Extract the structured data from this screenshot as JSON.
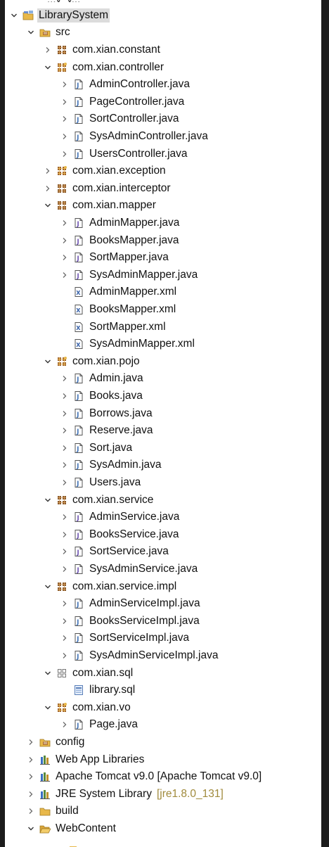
{
  "tree": {
    "cut_top_text": "...y_y...",
    "rows": [
      {
        "label": "LibrarySystem",
        "depth": 0,
        "expanded": true,
        "icon": "project-icon",
        "selected": true
      },
      {
        "label": "src",
        "depth": 1,
        "expanded": true,
        "icon": "source-folder-icon"
      },
      {
        "label": "com.xian.constant",
        "depth": 2,
        "expanded": false,
        "icon": "package-icon"
      },
      {
        "label": "com.xian.controller",
        "depth": 2,
        "expanded": true,
        "icon": "package-open-icon"
      },
      {
        "label": "AdminController.java",
        "depth": 3,
        "expanded": false,
        "icon": "java-class-icon"
      },
      {
        "label": "PageController.java",
        "depth": 3,
        "expanded": false,
        "icon": "java-class-icon"
      },
      {
        "label": "SortController.java",
        "depth": 3,
        "expanded": false,
        "icon": "java-class-icon"
      },
      {
        "label": "SysAdminController.java",
        "depth": 3,
        "expanded": false,
        "icon": "java-class-icon"
      },
      {
        "label": "UsersController.java",
        "depth": 3,
        "expanded": false,
        "icon": "java-class-icon"
      },
      {
        "label": "com.xian.exception",
        "depth": 2,
        "expanded": false,
        "icon": "package-open-icon"
      },
      {
        "label": "com.xian.interceptor",
        "depth": 2,
        "expanded": false,
        "icon": "package-icon"
      },
      {
        "label": "com.xian.mapper",
        "depth": 2,
        "expanded": true,
        "icon": "package-icon"
      },
      {
        "label": "AdminMapper.java",
        "depth": 3,
        "expanded": false,
        "icon": "java-interface-icon"
      },
      {
        "label": "BooksMapper.java",
        "depth": 3,
        "expanded": false,
        "icon": "java-interface-icon"
      },
      {
        "label": "SortMapper.java",
        "depth": 3,
        "expanded": false,
        "icon": "java-interface-icon"
      },
      {
        "label": "SysAdminMapper.java",
        "depth": 3,
        "expanded": false,
        "icon": "java-interface-icon"
      },
      {
        "label": "AdminMapper.xml",
        "depth": 3,
        "leaf": true,
        "icon": "xml-file-icon"
      },
      {
        "label": "BooksMapper.xml",
        "depth": 3,
        "leaf": true,
        "icon": "xml-file-icon"
      },
      {
        "label": "SortMapper.xml",
        "depth": 3,
        "leaf": true,
        "icon": "xml-file-icon"
      },
      {
        "label": "SysAdminMapper.xml",
        "depth": 3,
        "leaf": true,
        "icon": "xml-file-icon"
      },
      {
        "label": "com.xian.pojo",
        "depth": 2,
        "expanded": true,
        "icon": "package-open-icon"
      },
      {
        "label": "Admin.java",
        "depth": 3,
        "expanded": false,
        "icon": "java-class-icon"
      },
      {
        "label": "Books.java",
        "depth": 3,
        "expanded": false,
        "icon": "java-class-icon"
      },
      {
        "label": "Borrows.java",
        "depth": 3,
        "expanded": false,
        "icon": "java-class-icon"
      },
      {
        "label": "Reserve.java",
        "depth": 3,
        "expanded": false,
        "icon": "java-class-icon"
      },
      {
        "label": "Sort.java",
        "depth": 3,
        "expanded": false,
        "icon": "java-class-icon"
      },
      {
        "label": "SysAdmin.java",
        "depth": 3,
        "expanded": false,
        "icon": "java-class-icon"
      },
      {
        "label": "Users.java",
        "depth": 3,
        "expanded": false,
        "icon": "java-class-icon"
      },
      {
        "label": "com.xian.service",
        "depth": 2,
        "expanded": true,
        "icon": "package-icon"
      },
      {
        "label": "AdminService.java",
        "depth": 3,
        "expanded": false,
        "icon": "java-interface-icon"
      },
      {
        "label": "BooksService.java",
        "depth": 3,
        "expanded": false,
        "icon": "java-interface-icon"
      },
      {
        "label": "SortService.java",
        "depth": 3,
        "expanded": false,
        "icon": "java-interface-icon"
      },
      {
        "label": "SysAdminService.java",
        "depth": 3,
        "expanded": false,
        "icon": "java-interface-icon"
      },
      {
        "label": "com.xian.service.impl",
        "depth": 2,
        "expanded": true,
        "icon": "package-icon"
      },
      {
        "label": "AdminServiceImpl.java",
        "depth": 3,
        "expanded": false,
        "icon": "java-class-icon"
      },
      {
        "label": "BooksServiceImpl.java",
        "depth": 3,
        "expanded": false,
        "icon": "java-class-icon"
      },
      {
        "label": "SortServiceImpl.java",
        "depth": 3,
        "expanded": false,
        "icon": "java-class-icon"
      },
      {
        "label": "SysAdminServiceImpl.java",
        "depth": 3,
        "expanded": false,
        "icon": "java-class-icon"
      },
      {
        "label": "com.xian.sql",
        "depth": 2,
        "expanded": true,
        "icon": "package-empty-icon"
      },
      {
        "label": "library.sql",
        "depth": 3,
        "leaf": true,
        "icon": "sql-file-icon"
      },
      {
        "label": "com.xian.vo",
        "depth": 2,
        "expanded": true,
        "icon": "package-open-icon"
      },
      {
        "label": "Page.java",
        "depth": 3,
        "expanded": false,
        "icon": "java-class-icon"
      },
      {
        "label": "config",
        "depth": 1,
        "expanded": false,
        "icon": "source-folder-icon"
      },
      {
        "label": "Web App Libraries",
        "depth": 1,
        "expanded": false,
        "icon": "library-icon"
      },
      {
        "label": "Apache Tomcat v9.0 [Apache Tomcat v9.0]",
        "depth": 1,
        "expanded": false,
        "icon": "library-icon"
      },
      {
        "label": "JRE System Library",
        "decoration": "[jre1.8.0_131]",
        "depth": 1,
        "expanded": false,
        "icon": "library-icon"
      },
      {
        "label": "build",
        "depth": 1,
        "expanded": false,
        "icon": "folder-icon"
      },
      {
        "label": "WebContent",
        "depth": 1,
        "expanded": true,
        "icon": "folder-open-icon"
      }
    ]
  },
  "colors": {
    "selection": "#dcdcdc",
    "decoration": "#a08a3c",
    "package_brown": "#8a5a2b",
    "java_class_blue": "#3c6fb4",
    "interface_purple": "#6a4fb0",
    "folder_yellow": "#e8b84a",
    "background": "#ffffff"
  }
}
